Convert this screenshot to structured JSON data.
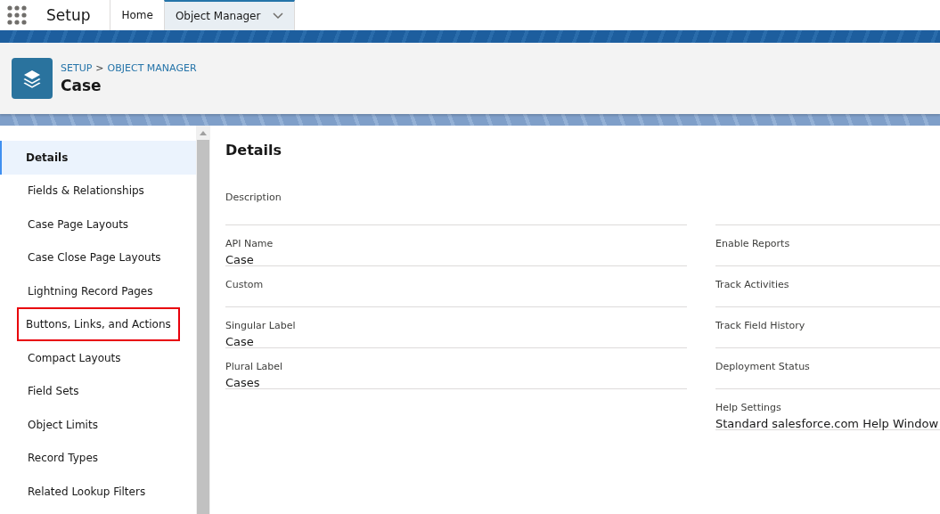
{
  "app": {
    "name": "Setup"
  },
  "tabs": [
    {
      "label": "Home",
      "selected": false,
      "menu": false
    },
    {
      "label": "Object Manager",
      "selected": true,
      "menu": true
    }
  ],
  "header": {
    "breadcrumb": [
      "SETUP",
      "OBJECT MANAGER"
    ],
    "separator": ">",
    "title": "Case"
  },
  "sidebar": {
    "items": [
      {
        "label": "Details",
        "selected": true,
        "highlighted": false
      },
      {
        "label": "Fields & Relationships",
        "selected": false,
        "highlighted": false
      },
      {
        "label": "Case Page Layouts",
        "selected": false,
        "highlighted": false
      },
      {
        "label": "Case Close Page Layouts",
        "selected": false,
        "highlighted": false
      },
      {
        "label": "Lightning Record Pages",
        "selected": false,
        "highlighted": false
      },
      {
        "label": "Buttons, Links, and Actions",
        "selected": false,
        "highlighted": true
      },
      {
        "label": "Compact Layouts",
        "selected": false,
        "highlighted": false
      },
      {
        "label": "Field Sets",
        "selected": false,
        "highlighted": false
      },
      {
        "label": "Object Limits",
        "selected": false,
        "highlighted": false
      },
      {
        "label": "Record Types",
        "selected": false,
        "highlighted": false
      },
      {
        "label": "Related Lookup Filters",
        "selected": false,
        "highlighted": false
      }
    ]
  },
  "details": {
    "title": "Details",
    "description": {
      "label": "Description"
    },
    "left_fields": [
      {
        "label": "API Name",
        "value": "Case"
      },
      {
        "label": "Custom"
      },
      {
        "label": "Singular Label",
        "value": "Case"
      },
      {
        "label": "Plural Label",
        "value": "Cases"
      }
    ],
    "right_fields": [
      {
        "label": "Enable Reports"
      },
      {
        "label": "Track Activities"
      },
      {
        "label": "Track Field History"
      },
      {
        "label": "Deployment Status"
      },
      {
        "label": "Help Settings",
        "value": "Standard salesforce.com Help Window"
      }
    ]
  }
}
